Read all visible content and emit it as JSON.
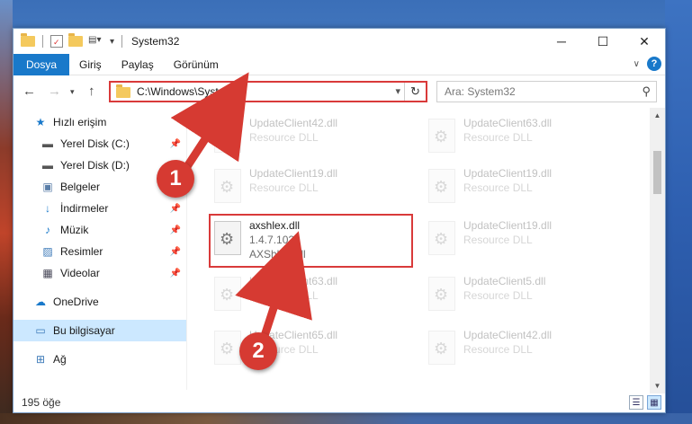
{
  "window": {
    "title": "System32",
    "controls": {
      "minimize": "─",
      "maximize": "☐",
      "close": "✕"
    }
  },
  "ribbon": {
    "tabs": [
      {
        "label": "Dosya",
        "active": true
      },
      {
        "label": "Giriş"
      },
      {
        "label": "Paylaş"
      },
      {
        "label": "Görünüm"
      }
    ]
  },
  "nav": {
    "address": "C:\\Windows\\System32",
    "search_placeholder": "Ara: System32"
  },
  "sidebar": {
    "items": [
      {
        "label": "Hızlı erişim",
        "icon": "star-icon",
        "pinned": false
      },
      {
        "label": "Yerel Disk (C:)",
        "icon": "drive-icon",
        "pinned": true
      },
      {
        "label": "Yerel Disk (D:)",
        "icon": "drive-icon",
        "pinned": true
      },
      {
        "label": "Belgeler",
        "icon": "documents-icon",
        "pinned": true
      },
      {
        "label": "İndirmeler",
        "icon": "download-icon",
        "pinned": true
      },
      {
        "label": "Müzik",
        "icon": "music-icon",
        "pinned": true
      },
      {
        "label": "Resimler",
        "icon": "pictures-icon",
        "pinned": true
      },
      {
        "label": "Videolar",
        "icon": "videos-icon",
        "pinned": true
      },
      {
        "label": "OneDrive",
        "icon": "cloud-icon"
      },
      {
        "label": "Bu bilgisayar",
        "icon": "computer-icon",
        "selected": true
      },
      {
        "label": "Ağ",
        "icon": "network-icon"
      }
    ]
  },
  "files": [
    {
      "name": "UpdateClient42.dll",
      "line2": "Resource DLL",
      "line3": ""
    },
    {
      "name": "UpdateClient63.dll",
      "line2": "Resource DLL",
      "line3": ""
    },
    {
      "name": "UpdateClient19.dll",
      "line2": "Resource DLL",
      "line3": ""
    },
    {
      "name": "UpdateClient19.dll",
      "line2": "Resource DLL",
      "line3": ""
    },
    {
      "name": "axshlex.dll",
      "line2": "1.4.7.1024",
      "line3": "AXShlEx.dll"
    },
    {
      "name": "UpdateClient19.dll",
      "line2": "Resource DLL",
      "line3": ""
    },
    {
      "name": "UpdateClient63.dll",
      "line2": "Resource DLL",
      "line3": ""
    },
    {
      "name": "UpdateClient5.dll",
      "line2": "Resource DLL",
      "line3": ""
    },
    {
      "name": "UpdateClient65.dll",
      "line2": "Resource DLL",
      "line3": ""
    },
    {
      "name": "UpdateClient42.dll",
      "line2": "Resource DLL",
      "line3": ""
    }
  ],
  "status": {
    "count": "195 öğe"
  },
  "annotations": {
    "badge1": "1",
    "badge2": "2",
    "color": "#d63a32"
  }
}
